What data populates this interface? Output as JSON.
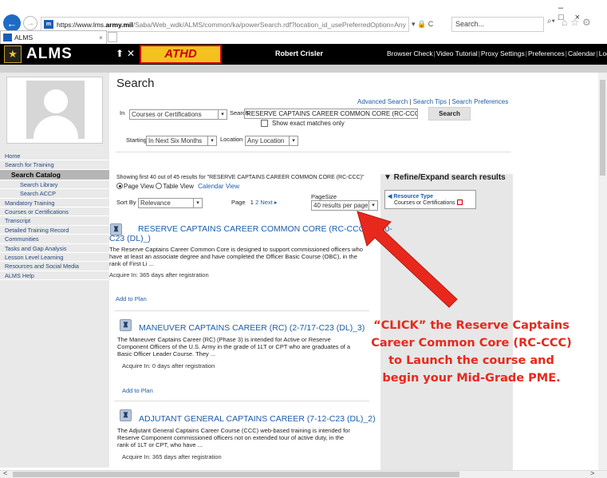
{
  "browser": {
    "url_prefix": "https://www.lms.",
    "url_domain": "army.mil",
    "url_path": "/Saba/Web_wdk/ALMS/common/ka/powerSearch.rdf?location_id_usePreferredOption=Any",
    "addr_controls": "▾ 🔒 C",
    "search_placeholder": "Search...",
    "search_dropdown": "⌕▾",
    "tab_title": "ALMS",
    "tab_close": "×",
    "fav_label": "m",
    "window_controls": "–□×",
    "right_icons": "⌂☆⚙"
  },
  "header": {
    "logo_glyph": "★",
    "logo_text": "ALMS",
    "icons": "⬆✕",
    "athd_text": "ATHD",
    "user_name": "Robert Crisler",
    "links": [
      "Browser Check",
      "Video Tutorial",
      "Proxy Settings",
      "Preferences",
      "Calendar",
      "Log Out"
    ]
  },
  "sidebar": {
    "items": [
      {
        "label": "Home"
      },
      {
        "label": "Search for Training"
      },
      {
        "label": "Search Catalog"
      },
      {
        "label": "Search Library"
      },
      {
        "label": "Search ACCP"
      },
      {
        "label": "Mandatory Training"
      },
      {
        "label": "Courses or Certifications"
      },
      {
        "label": "Transcript"
      },
      {
        "label": "Detailed Training Record"
      },
      {
        "label": "Communities"
      },
      {
        "label": "Tasks and Gap Analysis"
      },
      {
        "label": "Lesson Level Learning"
      },
      {
        "label": "Resources and Social Media"
      },
      {
        "label": "ALMS Help"
      }
    ]
  },
  "search": {
    "page_title": "Search",
    "adv_links": [
      "Advanced Search",
      "Search Tips",
      "Search Preferences"
    ],
    "in_label": "In",
    "in_value": "Courses or Certifications",
    "search_label": "Search",
    "search_value": "RESERVE CAPTAINS CAREER COMMON CORE (RC-CCC",
    "search_button": "Search",
    "exact_label": "Show exact matches only",
    "starting_label": "Starting",
    "starting_value": "In Next Six Months",
    "location_label": "Location",
    "location_value": "Any Location",
    "dd_glyph": "▾"
  },
  "results_bar": {
    "showing": "Showing first 40 out of 45 results  for \"RESERVE CAPTAINS CAREER COMMON CORE (RC-CCC)\"",
    "page_view": "Page View",
    "table_view": "Table View",
    "calendar_view": "Calendar View",
    "sort_label": "Sort By",
    "sort_value": "Relevance",
    "page_label": "Page",
    "page_current": "1",
    "page_other": "2",
    "next_label": "Next ▸",
    "pagesize_label": "PageSize",
    "pagesize_value": "40 results per page"
  },
  "refine": {
    "title": "▼ Refine/Expand search results",
    "resource_type": "◀ Resource Type",
    "resource_item": "Courses or Certifications"
  },
  "results": [
    {
      "title_line1": "RESERVE CAPTAINS CAREER COMMON CORE (RC-CCC) (9-00-",
      "title_line2": "C23 (DL)_)",
      "desc": "The Reserve Captains Career Common Core is designed to support commissioned officers who have at least an associate degree and have completed the Officer Basic Course (OBC), in the rank of First Li  ...",
      "acquire": "Acquire In:  365  days after registration",
      "add": "Add to Plan"
    },
    {
      "title_line1": "MANEUVER CAPTAINS CAREER (RC) (2-7/17-C23 (DL)_3)",
      "desc": "The Maneuver Captains Career (RC) (Phase 3) is intended for Active or Reserve Component Officers of the U.S. Army in the grade of 1LT or CPT who are graduates of a Basic Officer Leader Course. They  ...",
      "acquire": "Acquire In:  0  days after registration",
      "add": "Add to Plan"
    },
    {
      "title_line1": "ADJUTANT GENERAL CAPTAINS CAREER (7-12-C23 (DL)_2)",
      "desc": "The Adjutant General Captains Career Course (CCC) web-based training is intended for Reserve Component commissioned officers not on extended tour of active duty, in the rank of 1LT or CPT, who have  ...",
      "acquire": "Acquire In:  365  days after registration"
    }
  ],
  "result_icon_glyph": "♜",
  "callout": {
    "lines": [
      "“CLICK” the Reserve Captains",
      "Career Common Core (RC-CCC)",
      "to Launch the course and",
      "begin your Mid-Grade PME."
    ],
    "color": "#e8281c"
  },
  "scroll": {
    "left": "<",
    "right": ">"
  }
}
